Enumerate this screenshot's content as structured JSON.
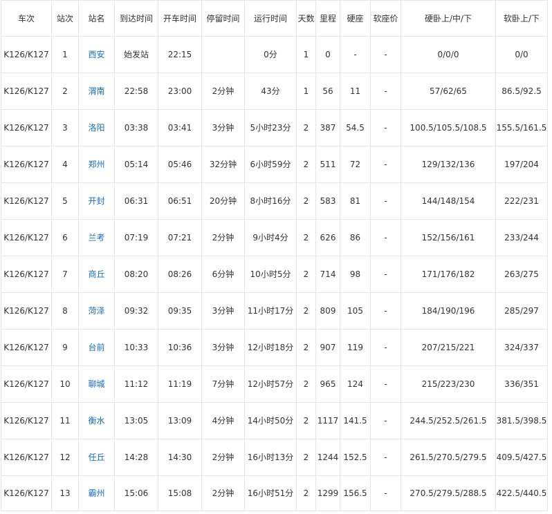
{
  "headers": [
    "车次",
    "站次",
    "站名",
    "到达时间",
    "开车时间",
    "停留时间",
    "运行时间",
    "天数",
    "里程",
    "硬座",
    "软座价",
    "硬卧上/中/下",
    "软卧上/下"
  ],
  "rows": [
    [
      "K126/K127",
      "1",
      "西安",
      "始发站",
      "22:15",
      "",
      "0分",
      "1",
      "0",
      "-",
      "-",
      "0/0/0",
      "0/0"
    ],
    [
      "K126/K127",
      "2",
      "渭南",
      "22:58",
      "23:00",
      "2分钟",
      "43分",
      "1",
      "56",
      "11",
      "-",
      "57/62/65",
      "86.5/92.5"
    ],
    [
      "K126/K127",
      "3",
      "洛阳",
      "03:38",
      "03:41",
      "3分钟",
      "5小时23分",
      "2",
      "387",
      "54.5",
      "-",
      "100.5/105.5/108.5",
      "155.5/161.5"
    ],
    [
      "K126/K127",
      "4",
      "郑州",
      "05:14",
      "05:46",
      "32分钟",
      "6小时59分",
      "2",
      "511",
      "72",
      "-",
      "129/132/136",
      "197/204"
    ],
    [
      "K126/K127",
      "5",
      "开封",
      "06:31",
      "06:51",
      "20分钟",
      "8小时16分",
      "2",
      "583",
      "81",
      "-",
      "144/148/154",
      "222/231"
    ],
    [
      "K126/K127",
      "6",
      "兰考",
      "07:19",
      "07:21",
      "2分钟",
      "9小时4分",
      "2",
      "626",
      "86",
      "-",
      "152/156/161",
      "233/244"
    ],
    [
      "K126/K127",
      "7",
      "商丘",
      "08:20",
      "08:26",
      "6分钟",
      "10小时5分",
      "2",
      "714",
      "98",
      "-",
      "171/176/182",
      "263/275"
    ],
    [
      "K126/K127",
      "8",
      "菏泽",
      "09:32",
      "09:35",
      "3分钟",
      "11小时17分",
      "2",
      "809",
      "105",
      "-",
      "184/190/196",
      "285/297"
    ],
    [
      "K126/K127",
      "9",
      "台前",
      "10:33",
      "10:36",
      "3分钟",
      "12小时18分",
      "2",
      "907",
      "119",
      "-",
      "207/215/221",
      "324/337"
    ],
    [
      "K126/K127",
      "10",
      "聊城",
      "11:12",
      "11:19",
      "7分钟",
      "12小时57分",
      "2",
      "965",
      "124",
      "-",
      "215/223/230",
      "336/351"
    ],
    [
      "K126/K127",
      "11",
      "衡水",
      "13:05",
      "13:09",
      "4分钟",
      "14小时50分",
      "2",
      "1117",
      "141.5",
      "-",
      "244.5/252.5/261.5",
      "381.5/398.5"
    ],
    [
      "K126/K127",
      "12",
      "任丘",
      "14:28",
      "14:30",
      "2分钟",
      "16小时13分",
      "2",
      "1244",
      "152.5",
      "-",
      "261.5/270.5/279.5",
      "409.5/427.5"
    ],
    [
      "K126/K127",
      "13",
      "霸州",
      "15:06",
      "15:08",
      "2分钟",
      "16小时51分",
      "2",
      "1299",
      "156.5",
      "-",
      "270.5/279.5/288.5",
      "422.5/440.5"
    ]
  ]
}
